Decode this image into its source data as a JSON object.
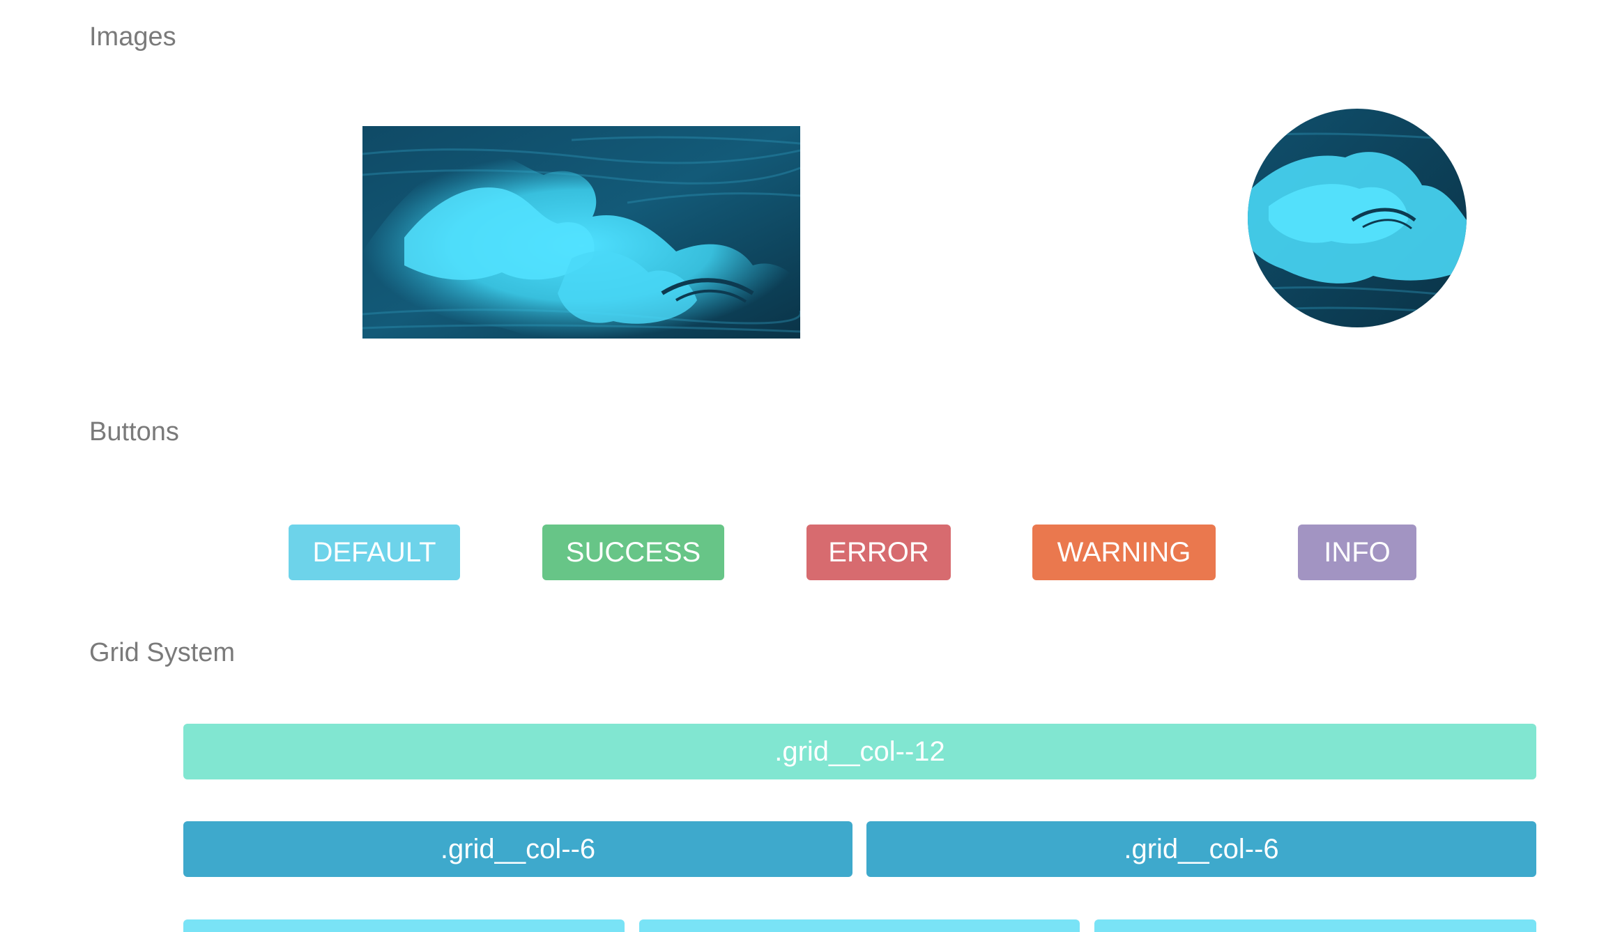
{
  "sections": {
    "images": {
      "title": "Images"
    },
    "buttons": {
      "title": "Buttons",
      "items": [
        {
          "label": "DEFAULT",
          "color": "#6dd3ea"
        },
        {
          "label": "SUCCESS",
          "color": "#67c587"
        },
        {
          "label": "ERROR",
          "color": "#d76b6f"
        },
        {
          "label": "WARNING",
          "color": "#ea784e"
        },
        {
          "label": "INFO",
          "color": "#a294c2"
        }
      ]
    },
    "grid": {
      "title": "Grid System",
      "rows": [
        [
          {
            "label": ".grid__col--12",
            "color": "#81e6d1"
          }
        ],
        [
          {
            "label": ".grid__col--6",
            "color": "#3ea9cc"
          },
          {
            "label": ".grid__col--6",
            "color": "#3ea9cc"
          }
        ],
        [
          {
            "label": "",
            "color": "#79e3f6"
          },
          {
            "label": "",
            "color": "#79e3f6"
          },
          {
            "label": "",
            "color": "#79e3f6"
          }
        ]
      ]
    }
  },
  "colors": {
    "heading": "#7a7a7a",
    "wave_dark": "#0e3e55",
    "wave_foam": "#3fd0ee"
  }
}
